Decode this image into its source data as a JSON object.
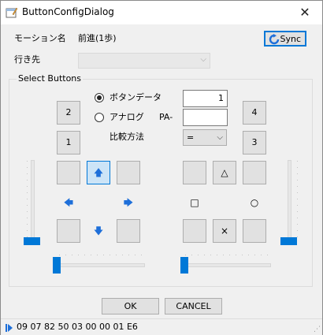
{
  "window": {
    "title": "ButtonConfigDialog"
  },
  "header": {
    "motion_label": "モーション名",
    "motion_value": "前進(1歩)",
    "sync_label": "Sync",
    "destination_label": "行き先",
    "destination_value": ""
  },
  "group": {
    "title": "Select Buttons",
    "radio_button_data": "ボタンデータ",
    "radio_analog": "アナログ",
    "button_data_value": "1",
    "pa_label": "PA-",
    "pa_value": "",
    "compare_label": "比較方法",
    "compare_value": "="
  },
  "buttons": {
    "b2": "2",
    "b1": "1",
    "b4": "4",
    "b3": "3",
    "up": "🡅",
    "left": "🡄",
    "right": "🡆",
    "down": "🡇",
    "triangle": "△",
    "square": "□",
    "circle": "○",
    "cross": "×"
  },
  "controls": {
    "radio_selected": "button_data",
    "slider_left_v": 0,
    "slider_left_h": 0,
    "slider_right_h": 0,
    "slider_right_v": 0
  },
  "footer": {
    "ok_label": "OK",
    "cancel_label": "CANCEL",
    "status_text": "09 07 82 50 03 00 00 01 E6"
  },
  "colors": {
    "accent": "#0078d7",
    "window_bg": "#f0f0f0",
    "button_bg": "#e1e1e1",
    "arrow_blue": "#1e6fd9"
  },
  "icons": {
    "app": "settings-form-icon",
    "close": "close-icon",
    "sync": "refresh-icon",
    "status": "play-marker-icon"
  }
}
